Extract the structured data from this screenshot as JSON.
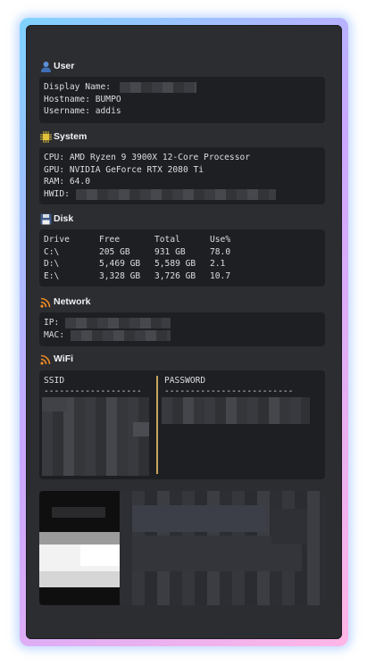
{
  "sections": {
    "user": {
      "title": "User",
      "icon": "user-icon",
      "lines": {
        "display_name_label": "Display Name:",
        "hostname": "Hostname: BUMPO",
        "username": "Username: addis"
      }
    },
    "system": {
      "title": "System",
      "icon": "cpu-chip-icon",
      "lines": {
        "cpu": "CPU: AMD Ryzen 9 3900X 12-Core Processor",
        "gpu": "GPU: NVIDIA GeForce RTX 2080 Ti",
        "ram": "RAM: 64.0",
        "hwid_label": "HWID:"
      }
    },
    "disk": {
      "title": "Disk",
      "icon": "floppy-disk-icon",
      "columns": [
        "Drive",
        "Free",
        "Total",
        "Use%"
      ],
      "rows": [
        [
          "C:\\",
          "205 GB",
          "931 GB",
          "78.0"
        ],
        [
          "D:\\",
          "5,469 GB",
          "5,589 GB",
          "2.1"
        ],
        [
          "E:\\",
          "3,328 GB",
          "3,726 GB",
          "10.7"
        ]
      ]
    },
    "network": {
      "title": "Network",
      "icon": "signal-icon",
      "lines": {
        "ip_label": "IP:",
        "mac_label": "MAC:"
      }
    },
    "wifi": {
      "title": "WiFi",
      "icon": "wifi-icon",
      "ssid_header": "SSID",
      "password_header": "PASSWORD",
      "ssid_rule": "-------------------",
      "password_rule": "-------------------------"
    }
  },
  "colors": {
    "window_bg": "#2b2d31",
    "block_bg": "#1e1f22",
    "text": "#dbdee1",
    "header_text": "#f2f3f5",
    "border_glow_start": "#7fd3ff",
    "border_glow_end": "#ffb6e6"
  }
}
